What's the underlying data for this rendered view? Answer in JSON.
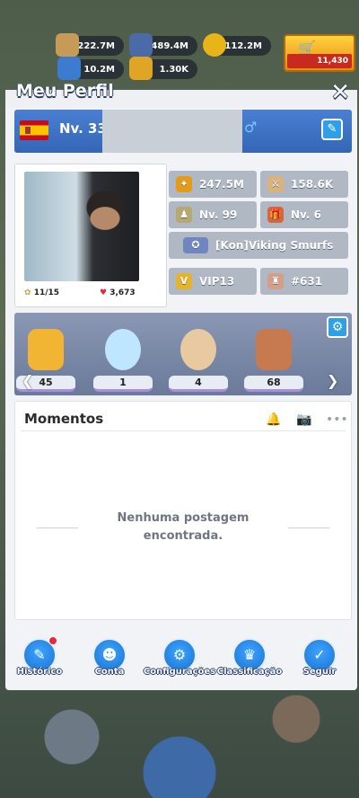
{
  "resources": [
    {
      "icon": "bread-icon",
      "value": "222.7M",
      "color": "#c79a58"
    },
    {
      "icon": "iron-icon",
      "value": "489.4M",
      "color": "#4a6aa8"
    },
    {
      "icon": "gold-coin-icon",
      "value": "112.2M",
      "color": "#e8b518"
    },
    {
      "icon": "oil-barrel-icon",
      "value": "10.2M",
      "color": "#3b7cd0"
    },
    {
      "icon": "card-icon",
      "value": "1.30K",
      "color": "#e0a524"
    }
  ],
  "shop": {
    "balance": "11,430"
  },
  "panel": {
    "title": "Meu Perfil",
    "close": "✕"
  },
  "profile": {
    "level": "Nv. 33",
    "gender": "♂",
    "avatar_stats": {
      "likes": "11/15",
      "hearts": "3,673"
    }
  },
  "stats": {
    "power": "247.5M",
    "kills": "158.6K",
    "commander_level": "Nv. 99",
    "gift_level": "Nv. 6",
    "alliance": "[Kon]Viking Smurfs",
    "vip": "VIP13",
    "rank": "#631"
  },
  "trophies": [
    {
      "name": "trophy-seven",
      "count": "45",
      "color": "#f2b433"
    },
    {
      "name": "trophy-ghost",
      "count": "1",
      "color": "#bfe6ff"
    },
    {
      "name": "trophy-teacup",
      "count": "4",
      "color": "#e8c9a0"
    },
    {
      "name": "trophy-cup",
      "count": "68",
      "color": "#c77a4e"
    }
  ],
  "moments": {
    "title": "Momentos",
    "empty_line1": "Nenhuma postagem",
    "empty_line2": "encontrada."
  },
  "nav": [
    {
      "name": "historico",
      "label": "Histórico",
      "icon": "✎",
      "dot": true
    },
    {
      "name": "conta",
      "label": "Conta",
      "icon": "☻",
      "dot": false
    },
    {
      "name": "configuracoes",
      "label": "Configurações",
      "icon": "⚙",
      "dot": false
    },
    {
      "name": "classificacao",
      "label": "Classificação",
      "icon": "🏆",
      "dot": false
    },
    {
      "name": "seguir",
      "label": "Seguir",
      "icon": "✓",
      "dot": false
    }
  ]
}
